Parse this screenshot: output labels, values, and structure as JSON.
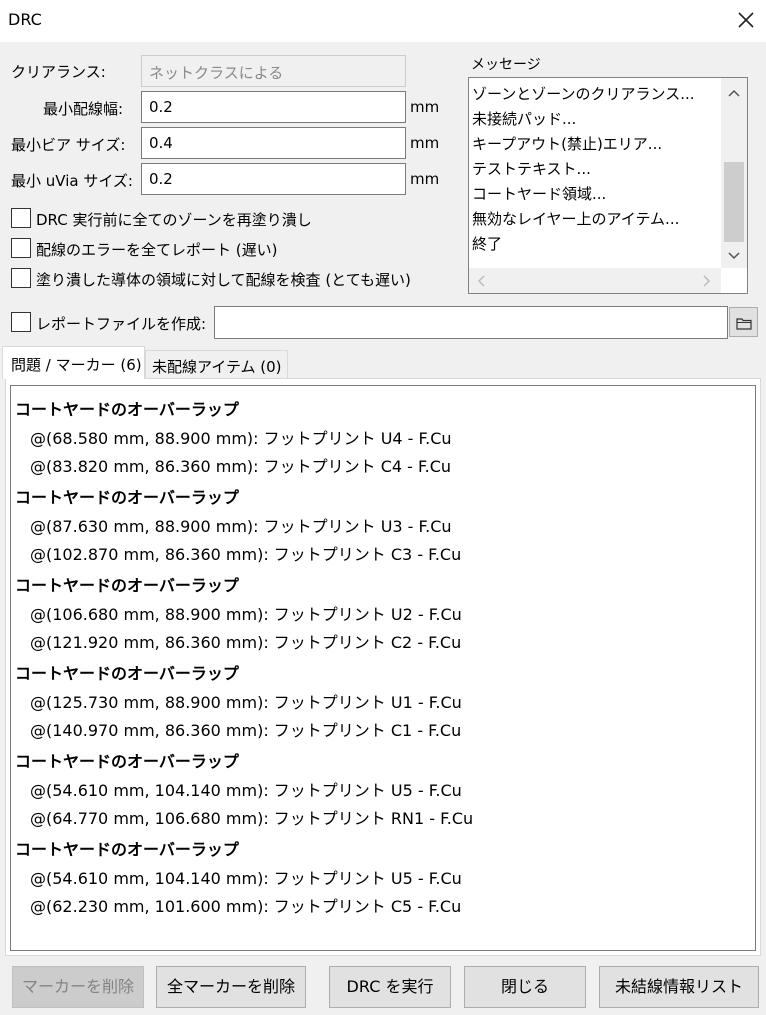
{
  "window": {
    "title": "DRC"
  },
  "settings": {
    "clearance_label": "クリアランス:",
    "clearance_value": "ネットクラスによる",
    "min_track_label": "最小配線幅:",
    "min_track_value": "0.2",
    "min_via_label": "最小ビア サイズ:",
    "min_via_value": "0.4",
    "min_uvia_label": "最小 uVia サイズ:",
    "min_uvia_value": "0.2",
    "unit": "mm"
  },
  "options": {
    "refill": "DRC 実行前に全てのゾーンを再塗り潰し",
    "report_all": "配線のエラーを全てレポート (遅い)",
    "test_zones": "塗り潰した導体の領域に対して配線を検査 (とても遅い)",
    "report_file": "レポートファイルを作成:",
    "report_file_path": ""
  },
  "messages": {
    "label": "メッセージ",
    "lines": [
      "ゾーンとゾーンのクリアランス...",
      "未接続パッド...",
      "キープアウト(禁止)エリア...",
      "テストテキスト...",
      "コートヤード領域...",
      "無効なレイヤー上のアイテム...",
      "終了"
    ]
  },
  "tabs": [
    {
      "label": "問題 / マーカー (6)",
      "active": true
    },
    {
      "label": "未配線アイテム (0)",
      "active": false
    }
  ],
  "issues": [
    {
      "title": "コートヤードのオーバーラップ",
      "items": [
        "@(68.580 mm, 88.900 mm): フットプリント U4 - F.Cu",
        "@(83.820 mm, 86.360 mm): フットプリント C4 - F.Cu"
      ]
    },
    {
      "title": "コートヤードのオーバーラップ",
      "items": [
        "@(87.630 mm, 88.900 mm): フットプリント U3 - F.Cu",
        "@(102.870 mm, 86.360 mm): フットプリント C3 - F.Cu"
      ]
    },
    {
      "title": "コートヤードのオーバーラップ",
      "items": [
        "@(106.680 mm, 88.900 mm): フットプリント U2 - F.Cu",
        "@(121.920 mm, 86.360 mm): フットプリント C2 - F.Cu"
      ]
    },
    {
      "title": "コートヤードのオーバーラップ",
      "items": [
        "@(125.730 mm, 88.900 mm): フットプリント U1 - F.Cu",
        "@(140.970 mm, 86.360 mm): フットプリント C1 - F.Cu"
      ]
    },
    {
      "title": "コートヤードのオーバーラップ",
      "items": [
        "@(54.610 mm, 104.140 mm): フットプリント U5 - F.Cu",
        "@(64.770 mm, 106.680 mm): フットプリント RN1 - F.Cu"
      ]
    },
    {
      "title": "コートヤードのオーバーラップ",
      "items": [
        "@(54.610 mm, 104.140 mm): フットプリント U5 - F.Cu",
        "@(62.230 mm, 101.600 mm): フットプリント C5 - F.Cu"
      ]
    }
  ],
  "buttons": {
    "delete_marker": "マーカーを削除",
    "delete_all": "全マーカーを削除",
    "run_drc": "DRC を実行",
    "close": "閉じる",
    "unconnected_list": "未結線情報リスト"
  },
  "icons": {
    "close": "close-icon",
    "folder": "folder-icon",
    "scroll_up": "chevron-up-icon",
    "scroll_down": "chevron-down-icon",
    "scroll_left": "chevron-left-icon",
    "scroll_right": "chevron-right-icon"
  }
}
